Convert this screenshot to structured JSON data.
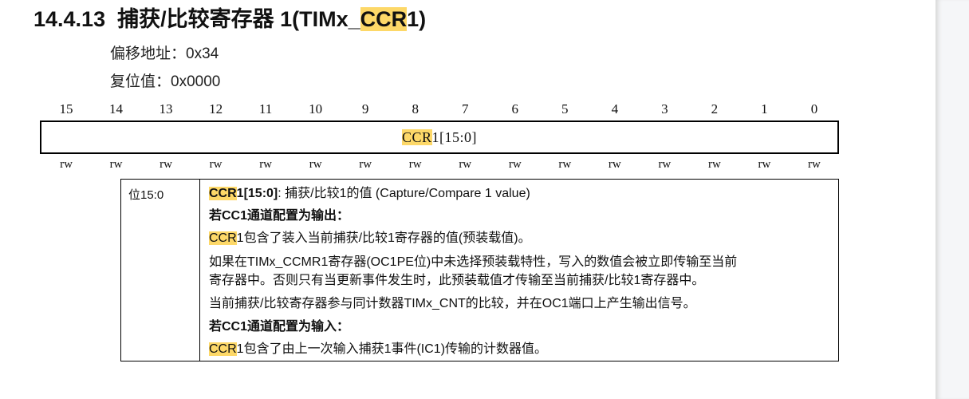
{
  "section": {
    "number": "14.4.13",
    "title_prefix": "捕获/比较寄存器 1(TIMx_",
    "title_highlight": "CCR",
    "title_suffix": "1)"
  },
  "offset": {
    "label": "偏移地址：",
    "value": "0x34"
  },
  "reset": {
    "label": "复位值：",
    "value": "0x0000"
  },
  "bits": [
    "15",
    "14",
    "13",
    "12",
    "11",
    "10",
    "9",
    "8",
    "7",
    "6",
    "5",
    "4",
    "3",
    "2",
    "1",
    "0"
  ],
  "register": {
    "field_highlight": "CCR",
    "field_rest": "1[15:0]"
  },
  "access": [
    "rw",
    "rw",
    "rw",
    "rw",
    "rw",
    "rw",
    "rw",
    "rw",
    "rw",
    "rw",
    "rw",
    "rw",
    "rw",
    "rw",
    "rw",
    "rw"
  ],
  "description": {
    "bit_range": "位15:0",
    "heading_hl": "CCR",
    "heading_bold": "1[15:0]",
    "heading_rest": ": 捕获/比较1的值 (Capture/Compare 1 value)",
    "output_heading": "若CC1通道配置为输出：",
    "output_line1_hl": "CCR",
    "output_line1": "1包含了装入当前捕获/比较1寄存器的值(预装载值)。",
    "output_line2a": "如果在TIMx_CCMR1寄存器(OC1PE位)中未选择预装载特性，写入的数值会被立即传输至当前",
    "output_line2b": "寄存器中。否则只有当更新事件发生时，此预装载值才传输至当前捕获/比较1寄存器中。",
    "output_line3": "当前捕获/比较寄存器参与同计数器TIMx_CNT的比较，并在OC1端口上产生输出信号。",
    "input_heading": "若CC1通道配置为输入：",
    "input_line1_hl": "CCR",
    "input_line1": "1包含了由上一次输入捕获1事件(IC1)传输的计数器值。"
  },
  "colors": {
    "highlight": "#fdd868"
  }
}
